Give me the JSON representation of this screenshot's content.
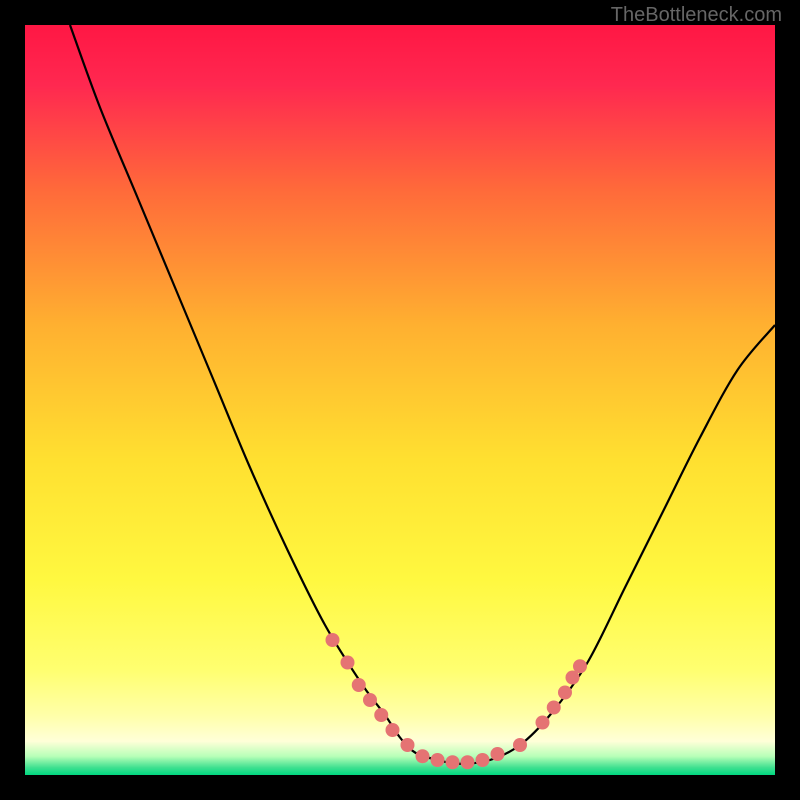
{
  "watermark": "TheBottleneck.com",
  "chart_data": {
    "type": "line",
    "title": "",
    "xlabel": "",
    "ylabel": "",
    "xlim": [
      0,
      100
    ],
    "ylim": [
      0,
      100
    ],
    "background": {
      "gradient_stops": [
        {
          "pos": 0.0,
          "color": "#ff1744"
        },
        {
          "pos": 0.08,
          "color": "#ff2850"
        },
        {
          "pos": 0.22,
          "color": "#ff6a3a"
        },
        {
          "pos": 0.4,
          "color": "#ffb030"
        },
        {
          "pos": 0.58,
          "color": "#ffe030"
        },
        {
          "pos": 0.74,
          "color": "#fff840"
        },
        {
          "pos": 0.86,
          "color": "#ffff70"
        },
        {
          "pos": 0.92,
          "color": "#ffffa8"
        },
        {
          "pos": 0.955,
          "color": "#ffffd8"
        },
        {
          "pos": 0.975,
          "color": "#b8ffb8"
        },
        {
          "pos": 0.99,
          "color": "#40e090"
        },
        {
          "pos": 1.0,
          "color": "#00d880"
        }
      ]
    },
    "series": [
      {
        "name": "bottleneck-curve",
        "color": "#000000",
        "x": [
          6,
          10,
          15,
          20,
          25,
          30,
          35,
          40,
          45,
          48,
          50,
          52,
          55,
          58,
          62,
          66,
          70,
          75,
          80,
          85,
          90,
          95,
          100
        ],
        "y": [
          100,
          89,
          77,
          65,
          53,
          41,
          30,
          20,
          12,
          8,
          5,
          3,
          2,
          1.5,
          2,
          4,
          8,
          15,
          25,
          35,
          45,
          54,
          60
        ]
      }
    ],
    "markers": {
      "name": "highlight-points",
      "color": "#e57373",
      "radius": 7,
      "points": [
        {
          "x": 41,
          "y": 18
        },
        {
          "x": 43,
          "y": 15
        },
        {
          "x": 44.5,
          "y": 12
        },
        {
          "x": 46,
          "y": 10
        },
        {
          "x": 47.5,
          "y": 8
        },
        {
          "x": 49,
          "y": 6
        },
        {
          "x": 51,
          "y": 4
        },
        {
          "x": 53,
          "y": 2.5
        },
        {
          "x": 55,
          "y": 2
        },
        {
          "x": 57,
          "y": 1.7
        },
        {
          "x": 59,
          "y": 1.7
        },
        {
          "x": 61,
          "y": 2
        },
        {
          "x": 63,
          "y": 2.8
        },
        {
          "x": 66,
          "y": 4
        },
        {
          "x": 69,
          "y": 7
        },
        {
          "x": 70.5,
          "y": 9
        },
        {
          "x": 72,
          "y": 11
        },
        {
          "x": 73,
          "y": 13
        },
        {
          "x": 74,
          "y": 14.5
        }
      ]
    }
  }
}
